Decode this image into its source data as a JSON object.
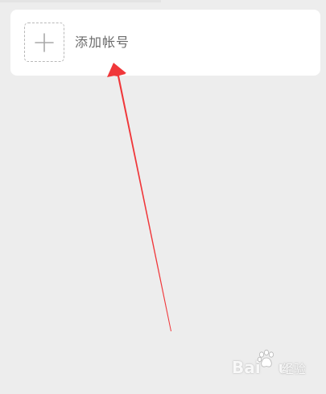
{
  "account": {
    "add_label": "添加帐号",
    "add_icon": "plus-icon"
  },
  "annotation": {
    "arrow_color": "#f0373a"
  },
  "watermark": {
    "latin": "Bai",
    "suffix": "u",
    "cn": "经验"
  }
}
